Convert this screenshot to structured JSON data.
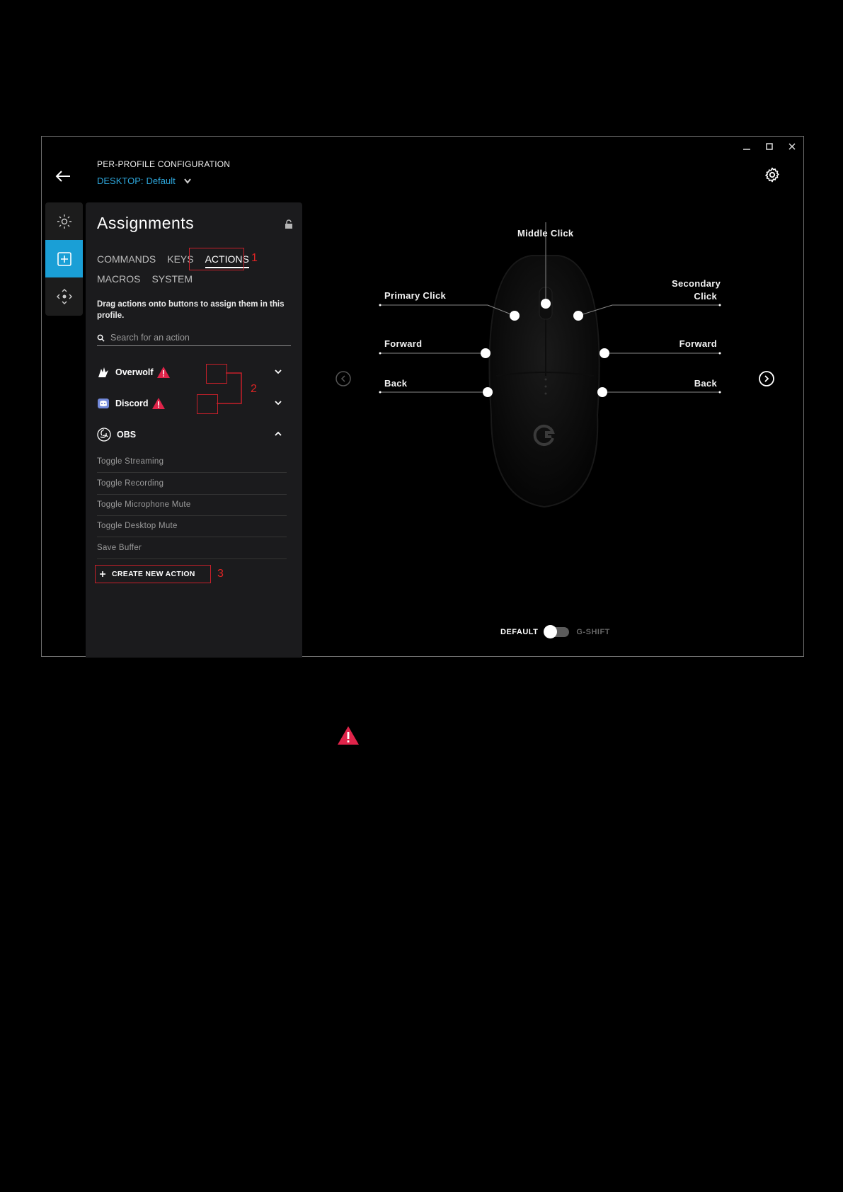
{
  "window": {
    "header_title": "PER-PROFILE CONFIGURATION",
    "profile_prefix": "DESKTOP:",
    "profile_name": "Default"
  },
  "panel": {
    "title": "Assignments",
    "tabs_row1": [
      "COMMANDS",
      "KEYS",
      "ACTIONS"
    ],
    "tabs_row2": [
      "MACROS",
      "SYSTEM"
    ],
    "active_tab": "ACTIONS",
    "hint": "Drag actions onto buttons to assign them in this profile.",
    "search_placeholder": "Search for an action",
    "groups": [
      {
        "name": "Overwolf",
        "warning": true,
        "expanded": false
      },
      {
        "name": "Discord",
        "warning": true,
        "expanded": false
      },
      {
        "name": "OBS",
        "warning": false,
        "expanded": true
      }
    ],
    "obs_actions": [
      "Toggle Streaming",
      "Toggle Recording",
      "Toggle Microphone Mute",
      "Toggle Desktop Mute",
      "Save Buffer"
    ],
    "create_label": "CREATE NEW ACTION"
  },
  "annotations": {
    "n1": "1",
    "n2": "2",
    "n3": "3"
  },
  "mouse": {
    "middle": "Middle Click",
    "primary": "Primary Click",
    "secondary_l1": "Secondary",
    "secondary_l2": "Click",
    "forward_left": "Forward",
    "forward_right": "Forward",
    "back_left": "Back",
    "back_right": "Back"
  },
  "toggle": {
    "left": "DEFAULT",
    "right": "G-SHIFT"
  },
  "colors": {
    "accent": "#1a9fd6",
    "annotation": "#c7202a",
    "warning": "#e0244a"
  }
}
